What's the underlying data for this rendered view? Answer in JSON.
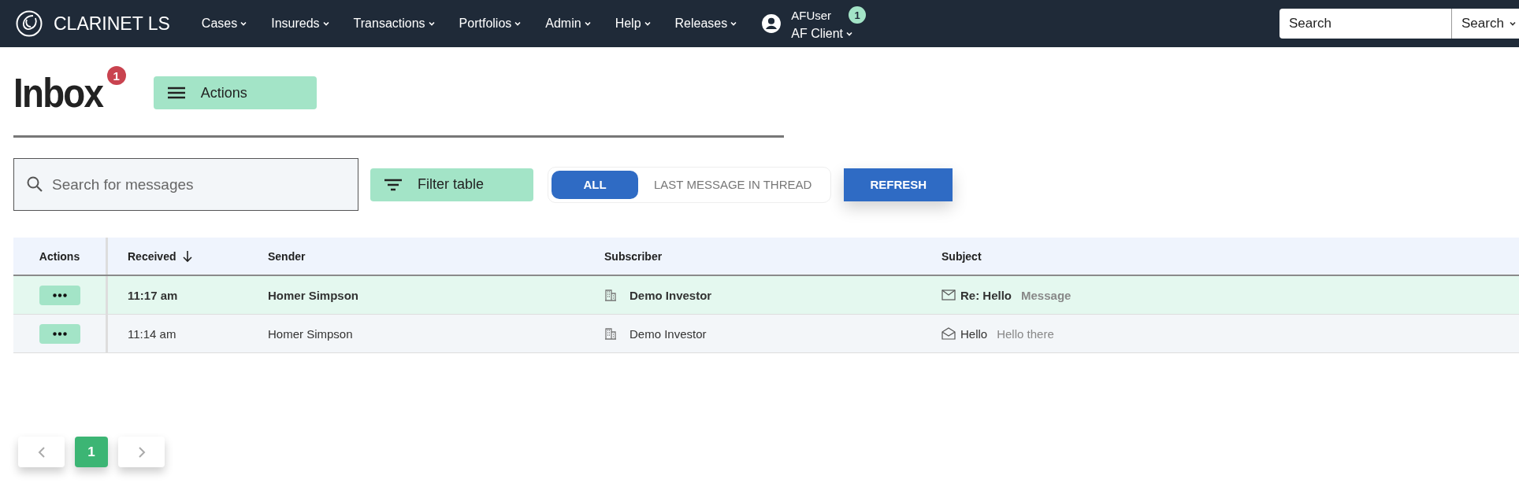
{
  "navbar": {
    "brand": "CLARINET LS",
    "menus": [
      "Cases",
      "Insureds",
      "Transactions",
      "Portfolios",
      "Admin",
      "Help",
      "Releases"
    ],
    "user": {
      "name": "AFUser",
      "badge": "1",
      "client": "AF Client"
    },
    "search": {
      "placeholder": "Search",
      "scope": "Search"
    }
  },
  "page": {
    "title": "Inbox",
    "badge": "1",
    "actions_button": "Actions"
  },
  "toolbar": {
    "search": {
      "placeholder": "Search for messages"
    },
    "filter_button": "Filter table",
    "view_toggle": [
      {
        "label": "ALL",
        "selected": true
      },
      {
        "label": "LAST MESSAGE IN THREAD",
        "selected": false
      }
    ],
    "refresh_button": "REFRESH"
  },
  "table": {
    "columns": [
      "Actions",
      "Received",
      "Sender",
      "Subscriber",
      "Subject"
    ],
    "rows": [
      {
        "received": "11:17 am",
        "sender": "Homer Simpson",
        "subscriber": "Demo Investor",
        "subject": "Re: Hello",
        "preview": "Message",
        "unread": true
      },
      {
        "received": "11:14 am",
        "sender": "Homer Simpson",
        "subscriber": "Demo Investor",
        "subject": "Hello",
        "preview": "Hello there",
        "unread": false
      }
    ]
  },
  "pagination": {
    "pages": [
      {
        "label": "1",
        "selected": true
      }
    ]
  }
}
